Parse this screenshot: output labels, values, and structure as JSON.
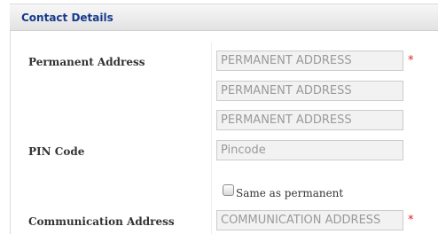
{
  "section": {
    "title": "Contact Details"
  },
  "labels": {
    "permanent_address": "Permanent Address",
    "pin_code": "PIN Code",
    "communication_address": "Communication Address"
  },
  "fields": {
    "permanent_address_1": {
      "value": "",
      "placeholder": "PERMANENT ADDRESS"
    },
    "permanent_address_2": {
      "value": "",
      "placeholder": "PERMANENT ADDRESS"
    },
    "permanent_address_3": {
      "value": "",
      "placeholder": "PERMANENT ADDRESS"
    },
    "pincode": {
      "value": "",
      "placeholder": "Pincode"
    },
    "communication_address_1": {
      "value": "",
      "placeholder": "COMMUNICATION ADDRESS"
    }
  },
  "checkbox": {
    "label": "Same as permanent",
    "checked": false
  },
  "required_marker": "*",
  "colors": {
    "header_text": "#173a8c",
    "required": "#e02020"
  }
}
